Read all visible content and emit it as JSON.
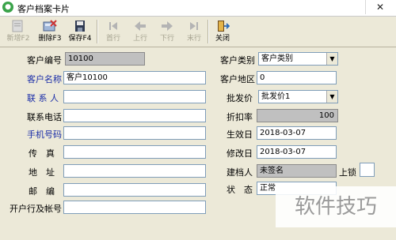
{
  "window": {
    "title": "客户档案卡片",
    "close_glyph": "✕"
  },
  "toolbar": {
    "new": "新增F2",
    "delete": "删除F3",
    "save": "保存F4",
    "first": "首行",
    "prev": "上行",
    "next": "下行",
    "last": "末行",
    "close": "关闭"
  },
  "form": {
    "customer_code": {
      "label": "客户编号",
      "value": "10100"
    },
    "customer_name": {
      "label": "客户名称",
      "value": "客户10100"
    },
    "contact": {
      "label": "联 系 人",
      "value": ""
    },
    "phone": {
      "label": "联系电话",
      "value": ""
    },
    "mobile": {
      "label": "手机号码",
      "value": ""
    },
    "fax": {
      "label": "传　真",
      "value": ""
    },
    "address": {
      "label": "地　址",
      "value": ""
    },
    "postcode": {
      "label": "邮　编",
      "value": ""
    },
    "bank_account": {
      "label": "开户行及帐号",
      "value": ""
    },
    "customer_type": {
      "label": "客户类别",
      "value": "客户类别"
    },
    "customer_region": {
      "label": "客户地区",
      "value": "0"
    },
    "wholesale_price": {
      "label": "批发价",
      "value": "批发价1"
    },
    "discount": {
      "label": "折扣率",
      "value": "100"
    },
    "effective_date": {
      "label": "生效日",
      "value": "2018-03-07"
    },
    "modified_date": {
      "label": "修改日",
      "value": "2018-03-07"
    },
    "creator": {
      "label": "建档人",
      "value": "未签名"
    },
    "lock": {
      "label": "上锁",
      "value": ""
    },
    "status": {
      "label": "状　态",
      "value": "正常"
    }
  },
  "watermark": "软件技巧"
}
